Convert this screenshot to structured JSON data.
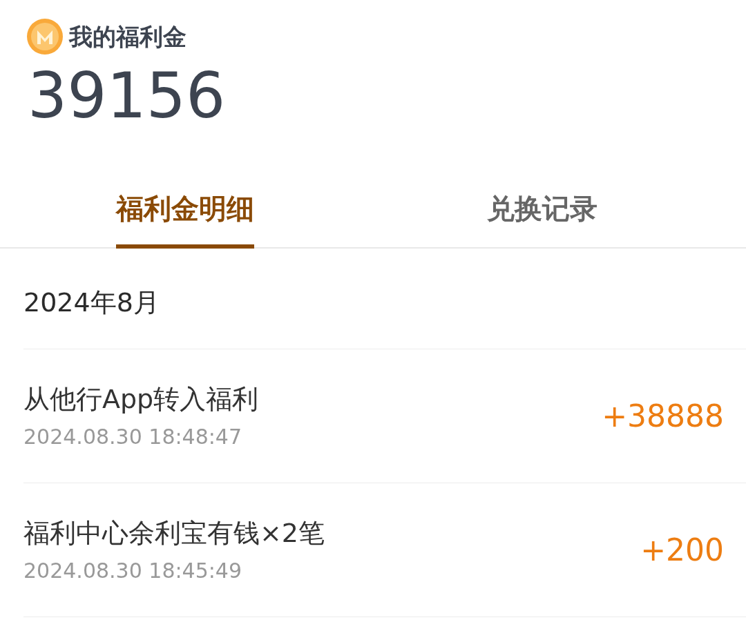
{
  "header": {
    "title": "我的福利金",
    "balance": "39156"
  },
  "tabs": [
    {
      "label": "福利金明细",
      "selected": true
    },
    {
      "label": "兑换记录",
      "selected": false
    }
  ],
  "month": "2024年8月",
  "records": [
    {
      "title": "从他行App转入福利",
      "time": "2024.08.30 18:48:47",
      "amount": "+38888"
    },
    {
      "title": "福利中心余利宝有钱×2笔",
      "time": "2024.08.30 18:45:49",
      "amount": "+200"
    }
  ]
}
